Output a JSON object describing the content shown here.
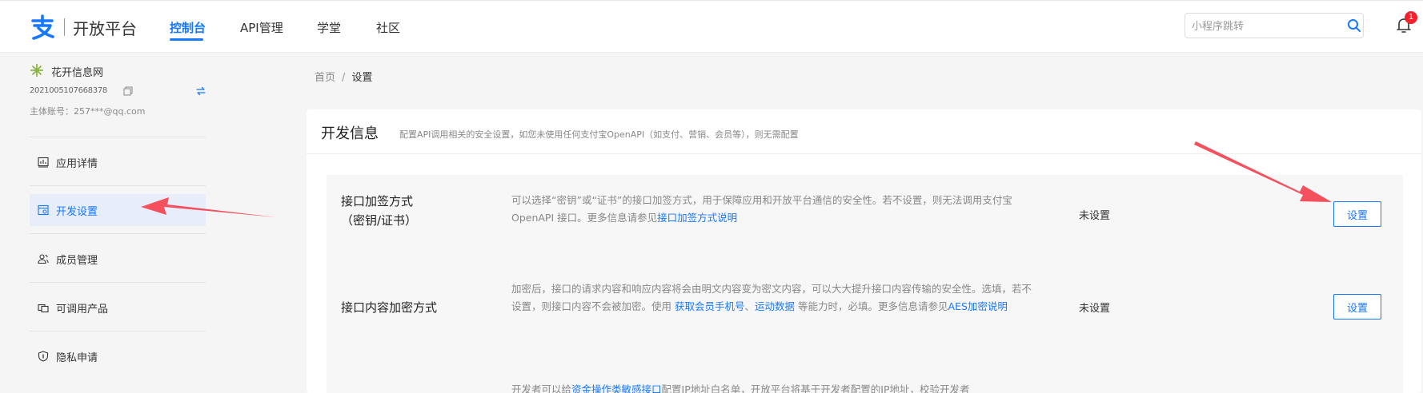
{
  "header": {
    "logo_text": "开放平台",
    "tabs": [
      {
        "label": "控制台",
        "active": true
      },
      {
        "label": "API管理",
        "active": false
      },
      {
        "label": "学堂",
        "active": false
      },
      {
        "label": "社区",
        "active": false
      }
    ],
    "search": {
      "placeholder": "小程序跳转",
      "value": ""
    },
    "notification_count": "1",
    "brand_color": "#1677ff"
  },
  "sidebar": {
    "app_name": "花开信息网",
    "app_id": "2021005107668378",
    "account": "主体账号：257***@qq.com",
    "items": [
      {
        "label": "应用详情",
        "icon": "chart-panel-icon",
        "active": false
      },
      {
        "label": "开发设置",
        "icon": "dev-settings-icon",
        "active": true
      },
      {
        "label": "成员管理",
        "icon": "members-icon",
        "active": false
      },
      {
        "label": "可调用产品",
        "icon": "products-icon",
        "active": false
      },
      {
        "label": "隐私申请",
        "icon": "shield-icon",
        "active": false
      }
    ]
  },
  "breadcrumb": {
    "home": "首页",
    "separator": "/",
    "current": "设置"
  },
  "dev_info": {
    "title": "开发信息",
    "description": "配置API调用相关的安全设置，如您未使用任何支付宝OpenAPI（如支付、营销、会员等），则无需配置",
    "rows": [
      {
        "title_line1": "接口加签方式",
        "title_line2": "（密钥/证书）",
        "desc_text": "可以选择“密钥”或“证书”的接口加签方式，用于保障应用和开放平台通信的安全性。若不设置，则无法调用支付宝 OpenAPI 接口。更多信息请参见",
        "desc_link": "接口加签方式说明",
        "status": "未设置",
        "button": "设置"
      },
      {
        "title_line1": "接口内容加密方式",
        "desc_text": "加密后，接口的请求内容和响应内容将会由明文内容变为密文内容，可以大大提升接口内容传输的安全性。选填，若不设置，则接口内容不会被加密。使用 ",
        "desc_link1": "获取会员手机号",
        "desc_sep": "、",
        "desc_link2": "运动数据",
        "desc_text2": " 等能力时，必填。更多信息请参见",
        "desc_link3": "AES加密说明",
        "status": "未设置",
        "button": "设置"
      },
      {
        "desc_text": "开发者可以给",
        "desc_link": "资金操作类敏感接口",
        "desc_text2": "配置IP地址白名单，开放平台将基于开发者配置的IP地址，校验开发者"
      }
    ]
  },
  "annotation_color": "#f4505e"
}
